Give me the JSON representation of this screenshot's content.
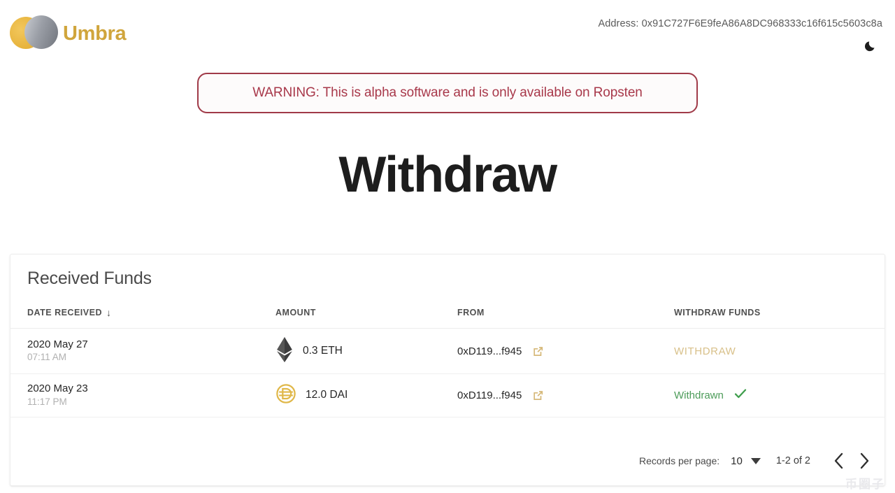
{
  "header": {
    "brand_name": "Umbra",
    "logo_icon": "umbra-eclipse-logo",
    "address_label": "Address: 0x91C727F6E9feA86A8DC968333c16f615c5603c8a",
    "theme_toggle_icon": "moon-icon"
  },
  "banner": {
    "text": "WARNING: This is alpha software and is only available on Ropsten",
    "border_color": "#a03a48",
    "text_color": "#a8384a"
  },
  "page": {
    "title": "Withdraw"
  },
  "table": {
    "title": "Received Funds",
    "columns": [
      {
        "label": "DATE RECEIVED",
        "sort_indicator": "↓"
      },
      {
        "label": "AMOUNT",
        "sort_indicator": ""
      },
      {
        "label": "FROM",
        "sort_indicator": ""
      },
      {
        "label": "WITHDRAW FUNDS",
        "sort_indicator": ""
      }
    ],
    "rows": [
      {
        "date": "2020 May 27",
        "time": "07:11 AM",
        "token_icon": "ethereum-icon",
        "amount": "0.3 ETH",
        "from": "0xD119...f945",
        "link_icon": "external-link-icon",
        "action_label": "WITHDRAW",
        "action_state": "actionable",
        "action_color": "#d8c089"
      },
      {
        "date": "2020 May 23",
        "time": "11:17 PM",
        "token_icon": "dai-icon",
        "amount": "12.0 DAI",
        "from": "0xD119...f945",
        "link_icon": "external-link-icon",
        "action_label": "Withdrawn",
        "action_state": "done",
        "action_color": "#4d9c5a",
        "status_icon": "check-icon"
      }
    ]
  },
  "paginator": {
    "records_per_page_label": "Records per page:",
    "records_per_page_value": "10",
    "range_label": "1-2 of 2",
    "prev_icon": "chevron-left-icon",
    "next_icon": "chevron-right-icon"
  },
  "watermark": {
    "text": "币圈子"
  }
}
